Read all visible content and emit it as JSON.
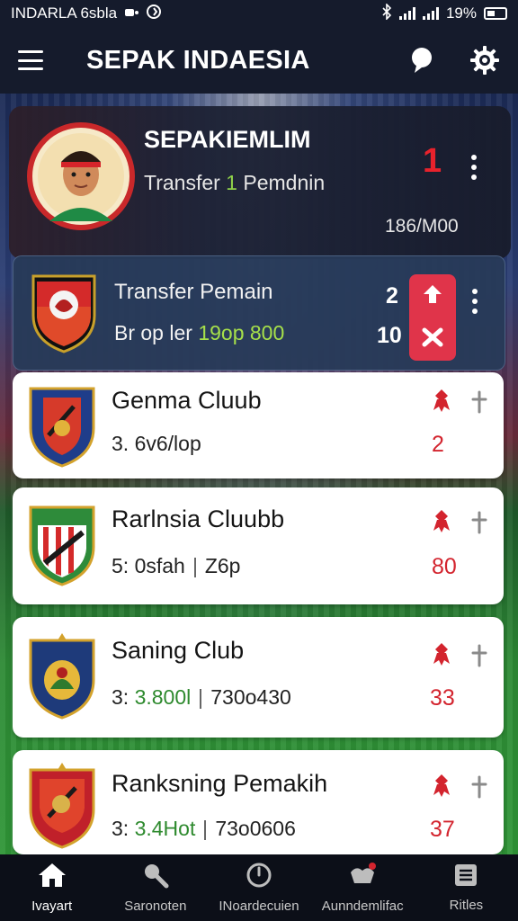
{
  "status_bar": {
    "left_text": "INDARLA 6sbla",
    "battery": "19%"
  },
  "app_bar": {
    "title": "SEPAK INDAESIA"
  },
  "featured": {
    "title": "SEPAKIEMLIM",
    "subtitle_prefix": "Transfer",
    "subtitle_highlight": "1",
    "subtitle_suffix": "Pemdnin",
    "count": "1",
    "meta": "186/M00"
  },
  "transfer_row": {
    "title": "Transfer Pemain",
    "subtitle_prefix": "Br op ler",
    "subtitle_highlight": "19op 800",
    "value_top": "2",
    "value_bottom": "10"
  },
  "clubs": [
    {
      "name": "Genma Cluub",
      "stats_plain": "3. 6v6/lop",
      "stats_highlight": "",
      "stats_tail": "",
      "num": "2",
      "accent": "#1f3d8a"
    },
    {
      "name": "Rarlnsia Cluubb",
      "stats_plain": "5: 0sfah",
      "stats_highlight": "",
      "stats_tail": "Z6p",
      "num": "80",
      "accent": "#2e8b3a"
    },
    {
      "name": "Saning Club",
      "stats_plain": "3:",
      "stats_highlight": "3.800l",
      "stats_tail": "730o430",
      "num": "33",
      "accent": "#1e3a7a"
    },
    {
      "name": "Ranksning Pemakih",
      "stats_plain": "3:",
      "stats_highlight": "3.4Hot",
      "stats_tail": "73o0606",
      "num": "37",
      "accent": "#c0202a"
    }
  ],
  "bottom_nav": [
    {
      "label": "Ivayart",
      "icon": "home-icon"
    },
    {
      "label": "Saronoten",
      "icon": "whistle-icon"
    },
    {
      "label": "INoardecuien",
      "icon": "timer-icon"
    },
    {
      "label": "Aunndemlifac",
      "icon": "trophy-icon"
    },
    {
      "label": "Ritles",
      "icon": "list-icon"
    }
  ],
  "colors": {
    "accent_red": "#e0344a",
    "header_bg": "#151b2c",
    "highlight_green": "#8fd24a"
  }
}
